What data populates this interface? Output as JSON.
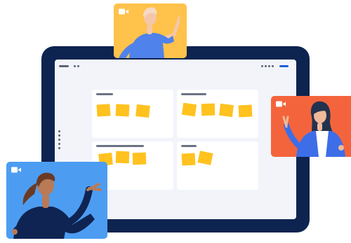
{
  "colors": {
    "tablet_frame": "#0d2350",
    "screen_background": "#f2f4fa",
    "card_background": "#ffffff",
    "sticky_note": "#ffc21f",
    "accent_blue": "#1f5fd6",
    "tile_top_background": "#ffc24b",
    "tile_right_background": "#f4643c",
    "tile_left_background": "#4c9df2"
  },
  "board": {
    "cards": [
      {
        "notes": 3
      },
      {
        "notes": 4
      },
      {
        "notes": 3
      },
      {
        "notes": 2
      }
    ]
  },
  "participants": [
    {
      "tile": "top",
      "icon": "video-camera-icon"
    },
    {
      "tile": "right",
      "icon": "video-camera-icon"
    },
    {
      "tile": "bottom-left",
      "icon": "video-camera-icon"
    }
  ]
}
